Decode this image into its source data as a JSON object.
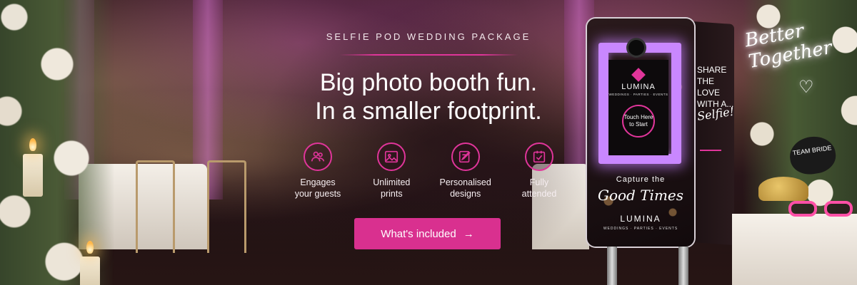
{
  "eyebrow": "SELFIE POD WEDDING PACKAGE",
  "headline": {
    "line1": "Big photo booth fun.",
    "line2": "In a smaller footprint."
  },
  "features": [
    {
      "icon": "guests-icon",
      "line1": "Engages",
      "line2": "your guests"
    },
    {
      "icon": "prints-icon",
      "line1": "Unlimited",
      "line2": "prints"
    },
    {
      "icon": "design-pen-icon",
      "line1": "Personalised",
      "line2": "designs"
    },
    {
      "icon": "checkbox-icon",
      "line1": "Fully",
      "line2": "attended"
    }
  ],
  "cta": {
    "label": "What's included",
    "arrow": "→"
  },
  "booth": {
    "brand": "LUMINA",
    "screen_sub": "WEDDINGS · PARTIES · EVENTS",
    "touch": "Touch Here to Start",
    "capture": "Capture the",
    "good_times": "Good Times",
    "footer_brand": "LUMINA",
    "footer_sub": "WEDDINGS · PARTIES · EVENTS",
    "side_text": "SHARE THE LOVE WITH A...",
    "side_script": "Selfie!"
  },
  "decor": {
    "neon": "Better Together",
    "sign": "TEAM BRIDE"
  },
  "colors": {
    "accent": "#d9308f",
    "neon_screen": "#c987ff"
  }
}
